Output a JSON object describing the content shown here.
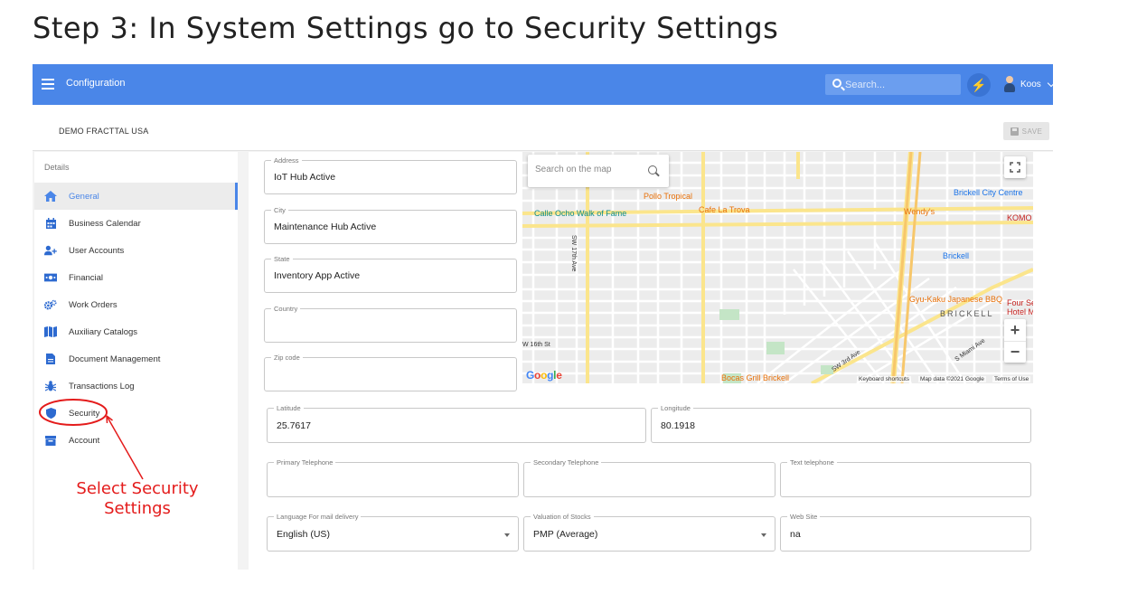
{
  "page": {
    "title": "Step 3: In System Settings go to Security Settings"
  },
  "topbar": {
    "app_title": "Configuration",
    "search_placeholder": "Search...",
    "user_name": "Koos",
    "bg_color": "#4a86e8"
  },
  "subheader": {
    "company": "DEMO FRACTTAL USA",
    "save_label": "SAVE"
  },
  "sidebar": {
    "header": "Details",
    "items": [
      {
        "label": "General",
        "icon": "home-icon",
        "active": true
      },
      {
        "label": "Business Calendar",
        "icon": "calendar-icon"
      },
      {
        "label": "User Accounts",
        "icon": "add-user-icon"
      },
      {
        "label": "Financial",
        "icon": "money-icon"
      },
      {
        "label": "Work Orders",
        "icon": "gears-icon"
      },
      {
        "label": "Auxiliary Catalogs",
        "icon": "map-icon"
      },
      {
        "label": "Document Management",
        "icon": "document-icon"
      },
      {
        "label": "Transactions Log",
        "icon": "bug-icon"
      },
      {
        "label": "Security",
        "icon": "shield-icon"
      },
      {
        "label": "Account",
        "icon": "account-box-icon"
      }
    ]
  },
  "form": {
    "address": {
      "label": "Address",
      "value": "IoT Hub Active"
    },
    "city": {
      "label": "City",
      "value": "Maintenance Hub Active"
    },
    "state": {
      "label": "State",
      "value": "Inventory App Active"
    },
    "country": {
      "label": "Country",
      "value": ""
    },
    "zip": {
      "label": "Zip code",
      "value": ""
    },
    "latitude": {
      "label": "Latitude",
      "value": "25.7617"
    },
    "longitude": {
      "label": "Longitude",
      "value": "80.1918"
    },
    "primary_tel": {
      "label": "Primary Telephone",
      "value": ""
    },
    "secondary_tel": {
      "label": "Secondary Telephone",
      "value": ""
    },
    "text_tel": {
      "label": "Text telephone",
      "value": ""
    },
    "language": {
      "label": "Language For mail delivery",
      "value": "English (US)"
    },
    "valuation": {
      "label": "Valuation of Stocks",
      "value": "PMP (Average)"
    },
    "website": {
      "label": "Web Site",
      "value": "na"
    }
  },
  "map": {
    "search_placeholder": "Search on the map",
    "labels": {
      "pollo": "Pollo Tropical",
      "calle_ocho": "Calle Ocho Walk of Fame",
      "cafe": "Cafe La Trova",
      "brickell_centre": "Brickell City Centre",
      "wendys": "Wendy's",
      "komodo": "KOMO",
      "brickell": "Brickell",
      "gyu": "Gyu-Kaku Japanese BBQ",
      "four": "Four Se",
      "hotel": "Hotel M",
      "brickell_area": "BRICKELL",
      "bocas": "Bocas Grill Brickell",
      "sw16": "W 16th St",
      "sw17ave": "SW 17th Ave",
      "sw3rd": "SW 3rd Ave",
      "smiami": "S Miami Ave"
    },
    "zoom_in": "+",
    "zoom_out": "−",
    "footer": {
      "shortcuts": "Keyboard shortcuts",
      "data": "Map data ©2021 Google",
      "terms": "Terms of Use"
    }
  },
  "annotation": {
    "text": "Select Security Settings",
    "color": "#e41b1b"
  }
}
